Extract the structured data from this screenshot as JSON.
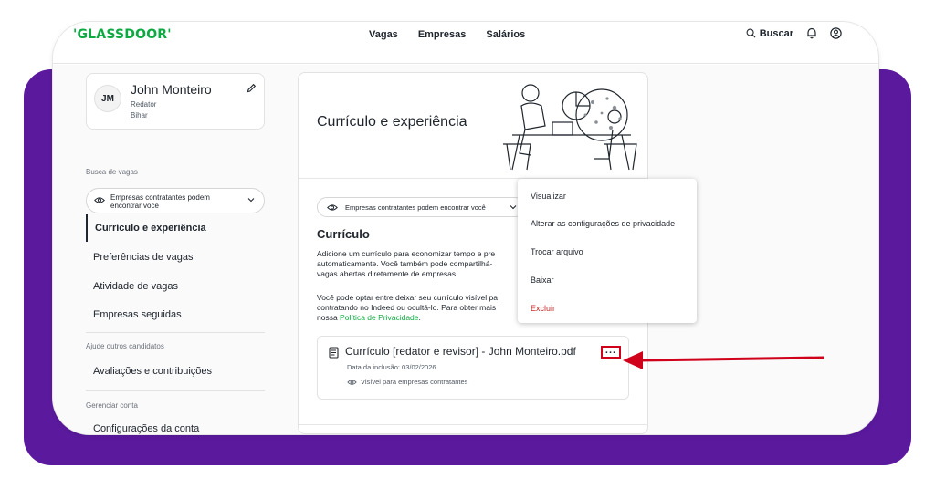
{
  "app": {
    "logo": "'GLASSDOOR'",
    "nav": [
      "Vagas",
      "Empresas",
      "Salários"
    ],
    "search_label": "Buscar"
  },
  "profile": {
    "initials": "JM",
    "name": "John Monteiro",
    "role": "Redator",
    "location": "Bihar"
  },
  "sidebar": {
    "section_job_search": "Busca de vagas",
    "visibility_label": "Empresas contratantes podem encontrar você",
    "items": [
      "Currículo e experiência",
      "Preferências de vagas",
      "Atividade de vagas",
      "Empresas seguidas"
    ],
    "section_help": "Ajude outros candidatos",
    "help_items": [
      "Avaliações e contribuições"
    ],
    "section_account": "Gerenciar conta",
    "account_items": [
      "Configurações da conta"
    ]
  },
  "main": {
    "title": "Currículo e experiência",
    "visibility_label": "Empresas contratantes podem encontrar você",
    "section_title": "Currículo",
    "paragraph1": "Adicione um currículo para economizar tempo e pre\nautomaticamente. Você também pode compartilhá-\nvagas abertas diretamente de empresas.",
    "paragraph2": "Você pode optar entre deixar seu currículo visível pa\ncontratando no Indeed ou ocultá-lo. Para obter mais\nnossa ",
    "paragraph2_link": "Política de Privacidade",
    "paragraph2_end": ".",
    "resume": {
      "title": "Currículo [redator e revisor] - John Monteiro.pdf",
      "date": "Data da inclusão: 03/02/2026",
      "visibility": "Visível para empresas contratantes",
      "more_label": "..."
    }
  },
  "menu": {
    "items": [
      "Visualizar",
      "Alterar as configurações de privacidade",
      "Trocar arquivo",
      "Baixar",
      "Excluir"
    ]
  },
  "colors": {
    "brand": "#0caa41",
    "backdrop": "#5b1a9e",
    "highlight": "#d0021b",
    "danger": "#c52b2b"
  }
}
